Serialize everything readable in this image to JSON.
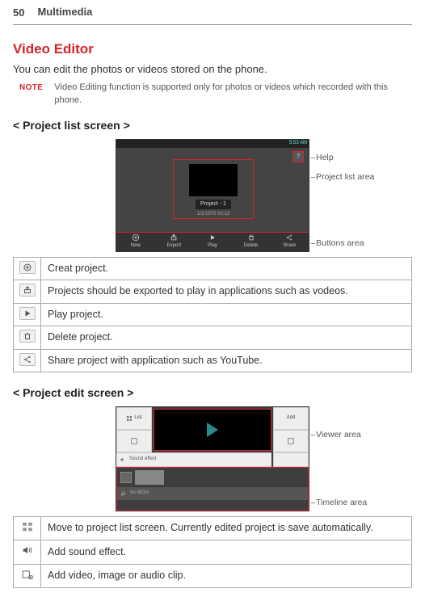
{
  "page_number": "50",
  "header_tab": "Multimedia",
  "section_title": "Video Editor",
  "intro": "You can edit the photos or videos stored on the phone.",
  "note_label": "NOTE",
  "note_text": "Video Editing function is supported only for photos or videos which recorded with this phone.",
  "sub1": "< Project list screen >",
  "sub2": "< Project edit screen >",
  "shot1": {
    "time": "5:53 AM",
    "help_q": "?",
    "proj_name": "Project - 1",
    "proj_date": "1/2/1970 00:12",
    "btns": [
      "New",
      "Export",
      "Play",
      "Delete",
      "Share"
    ]
  },
  "callouts1": {
    "help": "Help",
    "list": "Project list area",
    "buttons": "Buttons area"
  },
  "table1": {
    "r1": "Creat project.",
    "r2": "Projects should be exported to play in applications such as vodeos.",
    "r3": "Play project.",
    "r4": "Delete project.",
    "r5": "Share project with application such as YouTube."
  },
  "shot2": {
    "left_top": "List",
    "right_top": "Add",
    "mid": "Sound effect",
    "bgm": "No BGM"
  },
  "callouts2": {
    "viewer": "Viewer area",
    "timeline": "Timeline area"
  },
  "table2": {
    "r1": "Move to project list screen. Currently edited project is save automatically.",
    "r2": "Add sound effect.",
    "r3": "Add video, image or audio clip."
  }
}
